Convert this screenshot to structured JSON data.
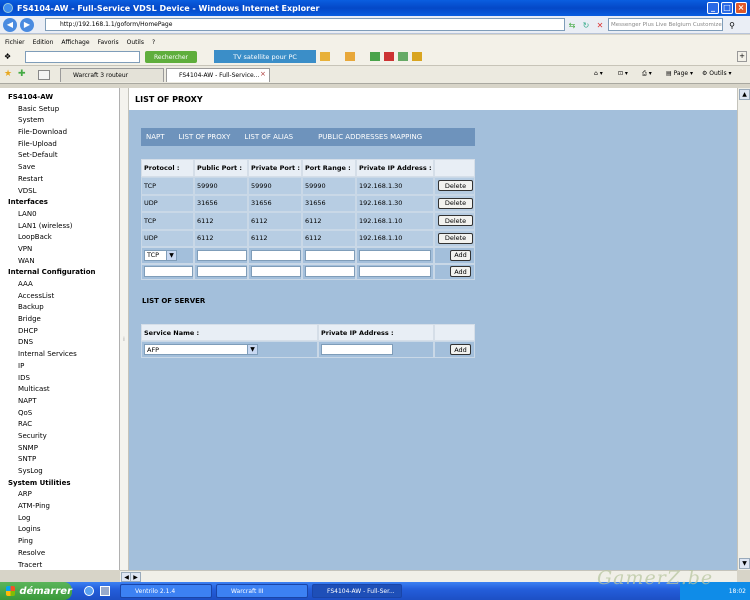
{
  "window": {
    "title": "FS4104-AW - Full-Service VDSL Device - Windows Internet Explorer"
  },
  "browser": {
    "url": "http://192.168.1.1/goform/HomePage",
    "search_placeholder": "Messenger Plus Live Belgium Customize",
    "menu": [
      "Fichier",
      "Edition",
      "Affichage",
      "Favoris",
      "Outils",
      "?"
    ],
    "search_button": "Rechercher",
    "tv_button": "TV satellite pour PC",
    "tabs": [
      "Warcraft 3 routeur",
      "FS4104-AW - Full-Service..."
    ],
    "tab_tools": {
      "page": "Page",
      "tools": "Outils"
    }
  },
  "sidebar": {
    "heading": "FS4104-AW",
    "groups": [
      {
        "title": "",
        "items": [
          "Basic Setup",
          "System",
          "File-Download",
          "File-Upload",
          "Set-Default",
          "Save",
          "Restart",
          "VDSL"
        ]
      },
      {
        "title": "Interfaces",
        "items": [
          "LAN0",
          "LAN1 (wireless)",
          "LoopBack",
          "VPN",
          "WAN"
        ]
      },
      {
        "title": "Internal Configuration",
        "items": [
          "AAA",
          "AccessList",
          "Backup",
          "Bridge",
          "DHCP",
          "DNS",
          "Internal Services",
          "IP",
          "IDS",
          "Multicast",
          "NAPT",
          "QoS",
          "RAC",
          "Security",
          "SNMP",
          "SNTP",
          "SysLog"
        ]
      },
      {
        "title": "System Utilities",
        "items": [
          "ARP",
          "ATM-Ping",
          "Log",
          "Logins",
          "Ping",
          "Resolve",
          "Tracert"
        ]
      }
    ]
  },
  "page": {
    "title": "LIST OF PROXY",
    "subnav": [
      "NAPT",
      "LIST OF PROXY",
      "LIST OF ALIAS",
      "PUBLIC ADDRESSES MAPPING"
    ],
    "proxy_table": {
      "headers": [
        "Protocol :",
        "Public Port :",
        "Private Port :",
        "Port Range :",
        "Private IP Address :"
      ],
      "rows": [
        [
          "TCP",
          "59990",
          "59990",
          "59990",
          "192.168.1.30"
        ],
        [
          "UDP",
          "31656",
          "31656",
          "31656",
          "192.168.1.30"
        ],
        [
          "TCP",
          "6112",
          "6112",
          "6112",
          "192.168.1.10"
        ],
        [
          "UDP",
          "6112",
          "6112",
          "6112",
          "192.168.1.10"
        ]
      ],
      "delete_label": "Delete",
      "add_label": "Add",
      "protocol_select": "TCP"
    },
    "server_section": {
      "title": "LIST OF SERVER",
      "headers": [
        "Service Name :",
        "Private IP Address :"
      ],
      "service_select": "AFP",
      "add_label": "Add"
    }
  },
  "taskbar": {
    "start": "démarrer",
    "tasks": [
      "Ventrilo 2.1.4",
      "Warcraft III",
      "FS4104-AW - Full-Ser..."
    ],
    "clock": "18:02"
  },
  "watermark": "GamerZ.be"
}
